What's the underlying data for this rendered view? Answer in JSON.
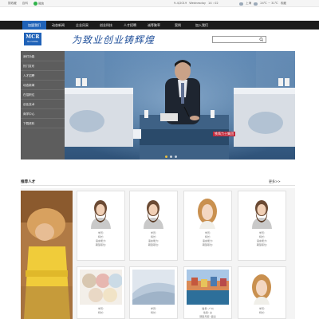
{
  "topbar": {
    "left_links": [
      "搜收藏",
      "百科",
      "微信"
    ],
    "wechat_label": "微信",
    "date": "9-4/2019",
    "weekday": "Wednesday",
    "time": "14 : 02",
    "weather_city": "上海",
    "weather_temp": "24℃ ~ 31℃",
    "weather_link": "收藏"
  },
  "nav": {
    "items": [
      "加盟我们",
      "动态新闻",
      "企业风采",
      "创业科技",
      "人才招聘",
      "诚等聚率",
      "案例",
      "加入我们"
    ]
  },
  "header": {
    "logo_text": "MCR",
    "logo_sub": "MAI SHANG",
    "slogan": "为致业创业铸辉煌",
    "search_placeholder": ""
  },
  "side_menu": {
    "items": [
      "我们功能",
      "热门发布",
      "人才招聘",
      "动态新闻",
      "在招职位",
      "创业技术",
      "商学中心",
      "下载资料"
    ]
  },
  "banner": {
    "caption": "铁铸力士集团",
    "slides": 3,
    "active": 0
  },
  "talent": {
    "title": "推荐人才",
    "more": "更多>>",
    "fields": [
      "学历:",
      "特长:",
      "语言能力:",
      "期望职位:"
    ],
    "short_fields": [
      "学历:",
      "特长:"
    ],
    "row3_fields": [
      "籍贯: 广州",
      "性别: 女",
      "期望月薪: 面议",
      "期望职位: 面议"
    ]
  }
}
